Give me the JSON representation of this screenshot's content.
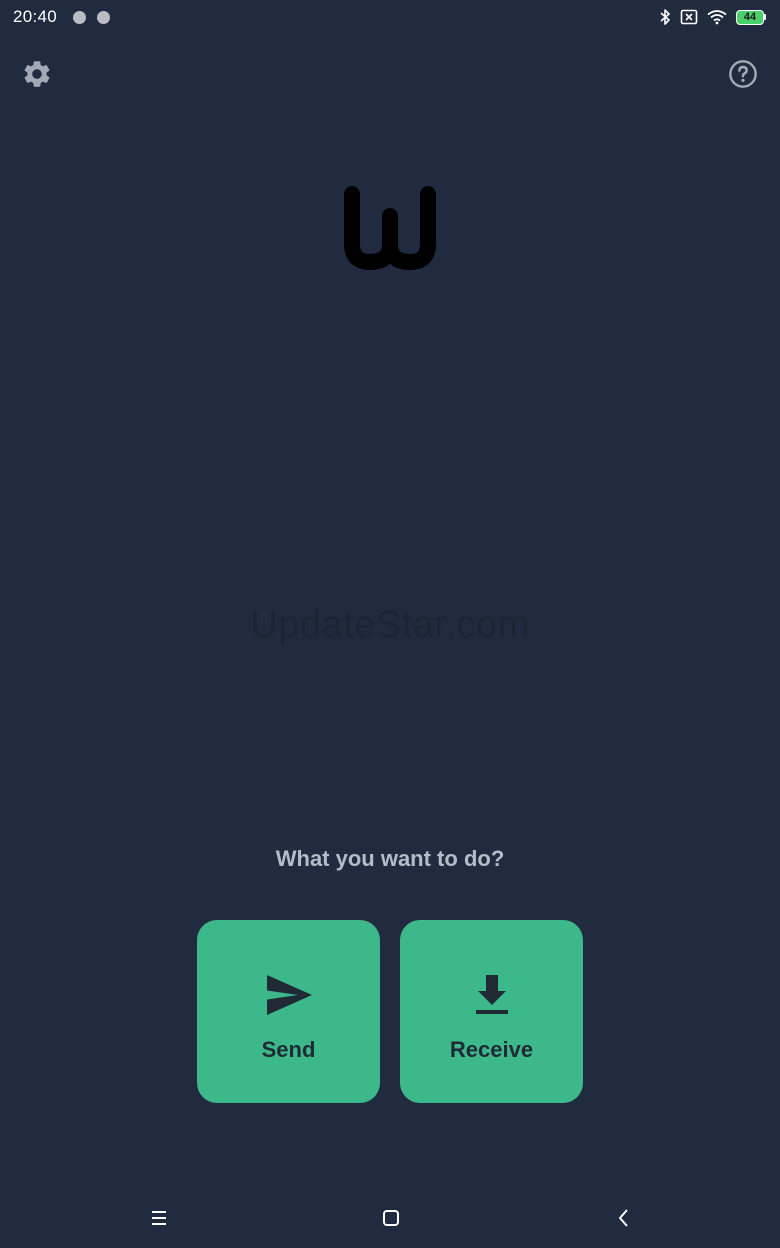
{
  "status_bar": {
    "time": "20:40",
    "battery_level": "44",
    "icons": [
      "notification-dot-icon",
      "notification-dot-icon",
      "bluetooth-icon",
      "no-sim-icon",
      "wifi-icon",
      "battery-icon"
    ]
  },
  "header": {
    "settings_icon": "gear-icon",
    "help_icon": "help-circle-icon"
  },
  "logo": {
    "glyph": "w-logo-icon"
  },
  "watermark": {
    "text": "UpdateStar.com"
  },
  "main": {
    "prompt": "What you want to do?",
    "actions": [
      {
        "label": "Send",
        "icon": "send-icon"
      },
      {
        "label": "Receive",
        "icon": "download-icon"
      }
    ]
  },
  "nav_bar": {
    "icons": [
      "menu-icon",
      "home-square-icon",
      "back-chevron-icon"
    ]
  },
  "colors": {
    "background": "#212b3f",
    "accent": "#3db88b",
    "prompt_text": "#b4bcc8",
    "button_text": "#1f2a35"
  }
}
